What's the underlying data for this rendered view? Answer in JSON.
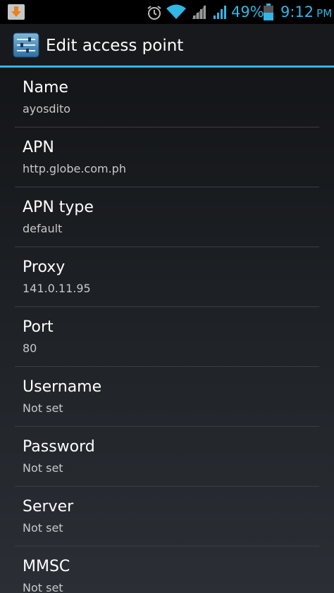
{
  "status_bar": {
    "notification_icon": "download-icon",
    "alarm_icon": "alarm-clock-icon",
    "wifi_icon": "wifi-icon",
    "signal_icons": [
      "signal-icon",
      "signal-icon"
    ],
    "battery_percent": "49%",
    "battery_icon": "battery-icon",
    "time": "9:12",
    "ampm": "PM",
    "accent_color": "#33b5e5"
  },
  "action_bar": {
    "icon": "settings-sliders-icon",
    "title": "Edit access point",
    "underline_color": "#33b5e5"
  },
  "settings": [
    {
      "title": "Name",
      "summary": "ayosdito"
    },
    {
      "title": "APN",
      "summary": "http.globe.com.ph"
    },
    {
      "title": "APN type",
      "summary": "default"
    },
    {
      "title": "Proxy",
      "summary": "141.0.11.95"
    },
    {
      "title": "Port",
      "summary": "80"
    },
    {
      "title": "Username",
      "summary": "Not set"
    },
    {
      "title": "Password",
      "summary": "Not set"
    },
    {
      "title": "Server",
      "summary": "Not set"
    },
    {
      "title": "MMSC",
      "summary": "Not set"
    }
  ]
}
